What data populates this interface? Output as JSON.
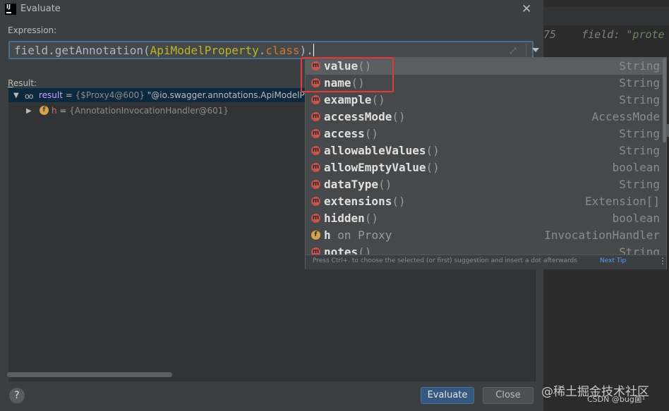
{
  "window": {
    "title": "Evaluate",
    "app_icon_text": "IJ"
  },
  "editor": {
    "line_number": "75",
    "keyword": "field:",
    "string": "\"prote"
  },
  "expression": {
    "label": "Expression:",
    "parts": [
      "field.getAnnotation(",
      "ApiModelProperty",
      ".",
      "class",
      ")."
    ]
  },
  "result": {
    "label_first": "R",
    "label_rest": "esult:",
    "rows": [
      {
        "name": "result",
        "eq": " = ",
        "value": "{$Proxy4@600} ",
        "str": "\"@io.swagger.annotations.ApiModelProp"
      },
      {
        "name": "h",
        "eq": " = ",
        "value": "{AnnotationInvocationHandler@601}"
      }
    ]
  },
  "completion": {
    "items": [
      {
        "name": "value",
        "parens": "()",
        "type": "String",
        "kind": "m",
        "selected": true
      },
      {
        "name": "name",
        "parens": "()",
        "type": "String",
        "kind": "m"
      },
      {
        "name": "example",
        "parens": "()",
        "type": "String",
        "kind": "m"
      },
      {
        "name": "accessMode",
        "parens": "()",
        "type": "AccessMode",
        "kind": "m"
      },
      {
        "name": "access",
        "parens": "()",
        "type": "String",
        "kind": "m"
      },
      {
        "name": "allowableValues",
        "parens": "()",
        "type": "String",
        "kind": "m"
      },
      {
        "name": "allowEmptyValue",
        "parens": "()",
        "type": "boolean",
        "kind": "m"
      },
      {
        "name": "dataType",
        "parens": "()",
        "type": "String",
        "kind": "m"
      },
      {
        "name": "extensions",
        "parens": "()",
        "type": "Extension[]",
        "kind": "m"
      },
      {
        "name": "hidden",
        "parens": "()",
        "type": "boolean",
        "kind": "m"
      },
      {
        "name": "h",
        "parens": " on Proxy",
        "type": "InvocationHandler",
        "kind": "f"
      },
      {
        "name": "notes",
        "parens": "()",
        "type": "String",
        "kind": "m"
      }
    ],
    "footer_hint": "Press Ctrl+. to choose the selected (or first) suggestion and insert a dot afterwards",
    "footer_link": "Next Tip"
  },
  "buttons": {
    "evaluate": "Evaluate",
    "close": "Close",
    "help": "?"
  },
  "watermark": {
    "line1": "@稀土掘金技术社区",
    "line2": "CSDN @bug菌¹"
  }
}
